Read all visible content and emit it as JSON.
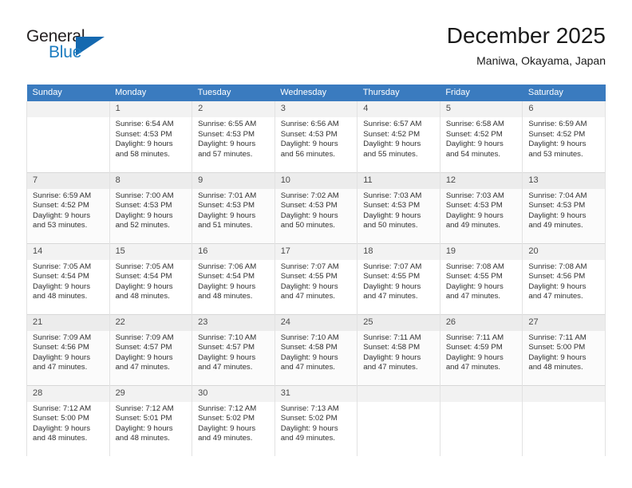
{
  "brand": {
    "name_top": "General",
    "name_bottom": "Blue",
    "accent_color": "#1c7cc0",
    "triangle_color": "#1569b0"
  },
  "header": {
    "title": "December 2025",
    "subtitle": "Maniwa, Okayama, Japan"
  },
  "calendar": {
    "header_bg": "#3a7bbf",
    "weekdays": [
      "Sunday",
      "Monday",
      "Tuesday",
      "Wednesday",
      "Thursday",
      "Friday",
      "Saturday"
    ],
    "labels": {
      "sunrise": "Sunrise:",
      "sunset": "Sunset:",
      "daylight": "Daylight:"
    },
    "weeks": [
      [
        {
          "day": "",
          "sunrise": "",
          "sunset": "",
          "daylight_1": "",
          "daylight_2": ""
        },
        {
          "day": "1",
          "sunrise": "Sunrise: 6:54 AM",
          "sunset": "Sunset: 4:53 PM",
          "daylight_1": "Daylight: 9 hours",
          "daylight_2": "and 58 minutes."
        },
        {
          "day": "2",
          "sunrise": "Sunrise: 6:55 AM",
          "sunset": "Sunset: 4:53 PM",
          "daylight_1": "Daylight: 9 hours",
          "daylight_2": "and 57 minutes."
        },
        {
          "day": "3",
          "sunrise": "Sunrise: 6:56 AM",
          "sunset": "Sunset: 4:53 PM",
          "daylight_1": "Daylight: 9 hours",
          "daylight_2": "and 56 minutes."
        },
        {
          "day": "4",
          "sunrise": "Sunrise: 6:57 AM",
          "sunset": "Sunset: 4:52 PM",
          "daylight_1": "Daylight: 9 hours",
          "daylight_2": "and 55 minutes."
        },
        {
          "day": "5",
          "sunrise": "Sunrise: 6:58 AM",
          "sunset": "Sunset: 4:52 PM",
          "daylight_1": "Daylight: 9 hours",
          "daylight_2": "and 54 minutes."
        },
        {
          "day": "6",
          "sunrise": "Sunrise: 6:59 AM",
          "sunset": "Sunset: 4:52 PM",
          "daylight_1": "Daylight: 9 hours",
          "daylight_2": "and 53 minutes."
        }
      ],
      [
        {
          "day": "7",
          "sunrise": "Sunrise: 6:59 AM",
          "sunset": "Sunset: 4:52 PM",
          "daylight_1": "Daylight: 9 hours",
          "daylight_2": "and 53 minutes."
        },
        {
          "day": "8",
          "sunrise": "Sunrise: 7:00 AM",
          "sunset": "Sunset: 4:53 PM",
          "daylight_1": "Daylight: 9 hours",
          "daylight_2": "and 52 minutes."
        },
        {
          "day": "9",
          "sunrise": "Sunrise: 7:01 AM",
          "sunset": "Sunset: 4:53 PM",
          "daylight_1": "Daylight: 9 hours",
          "daylight_2": "and 51 minutes."
        },
        {
          "day": "10",
          "sunrise": "Sunrise: 7:02 AM",
          "sunset": "Sunset: 4:53 PM",
          "daylight_1": "Daylight: 9 hours",
          "daylight_2": "and 50 minutes."
        },
        {
          "day": "11",
          "sunrise": "Sunrise: 7:03 AM",
          "sunset": "Sunset: 4:53 PM",
          "daylight_1": "Daylight: 9 hours",
          "daylight_2": "and 50 minutes."
        },
        {
          "day": "12",
          "sunrise": "Sunrise: 7:03 AM",
          "sunset": "Sunset: 4:53 PM",
          "daylight_1": "Daylight: 9 hours",
          "daylight_2": "and 49 minutes."
        },
        {
          "day": "13",
          "sunrise": "Sunrise: 7:04 AM",
          "sunset": "Sunset: 4:53 PM",
          "daylight_1": "Daylight: 9 hours",
          "daylight_2": "and 49 minutes."
        }
      ],
      [
        {
          "day": "14",
          "sunrise": "Sunrise: 7:05 AM",
          "sunset": "Sunset: 4:54 PM",
          "daylight_1": "Daylight: 9 hours",
          "daylight_2": "and 48 minutes."
        },
        {
          "day": "15",
          "sunrise": "Sunrise: 7:05 AM",
          "sunset": "Sunset: 4:54 PM",
          "daylight_1": "Daylight: 9 hours",
          "daylight_2": "and 48 minutes."
        },
        {
          "day": "16",
          "sunrise": "Sunrise: 7:06 AM",
          "sunset": "Sunset: 4:54 PM",
          "daylight_1": "Daylight: 9 hours",
          "daylight_2": "and 48 minutes."
        },
        {
          "day": "17",
          "sunrise": "Sunrise: 7:07 AM",
          "sunset": "Sunset: 4:55 PM",
          "daylight_1": "Daylight: 9 hours",
          "daylight_2": "and 47 minutes."
        },
        {
          "day": "18",
          "sunrise": "Sunrise: 7:07 AM",
          "sunset": "Sunset: 4:55 PM",
          "daylight_1": "Daylight: 9 hours",
          "daylight_2": "and 47 minutes."
        },
        {
          "day": "19",
          "sunrise": "Sunrise: 7:08 AM",
          "sunset": "Sunset: 4:55 PM",
          "daylight_1": "Daylight: 9 hours",
          "daylight_2": "and 47 minutes."
        },
        {
          "day": "20",
          "sunrise": "Sunrise: 7:08 AM",
          "sunset": "Sunset: 4:56 PM",
          "daylight_1": "Daylight: 9 hours",
          "daylight_2": "and 47 minutes."
        }
      ],
      [
        {
          "day": "21",
          "sunrise": "Sunrise: 7:09 AM",
          "sunset": "Sunset: 4:56 PM",
          "daylight_1": "Daylight: 9 hours",
          "daylight_2": "and 47 minutes."
        },
        {
          "day": "22",
          "sunrise": "Sunrise: 7:09 AM",
          "sunset": "Sunset: 4:57 PM",
          "daylight_1": "Daylight: 9 hours",
          "daylight_2": "and 47 minutes."
        },
        {
          "day": "23",
          "sunrise": "Sunrise: 7:10 AM",
          "sunset": "Sunset: 4:57 PM",
          "daylight_1": "Daylight: 9 hours",
          "daylight_2": "and 47 minutes."
        },
        {
          "day": "24",
          "sunrise": "Sunrise: 7:10 AM",
          "sunset": "Sunset: 4:58 PM",
          "daylight_1": "Daylight: 9 hours",
          "daylight_2": "and 47 minutes."
        },
        {
          "day": "25",
          "sunrise": "Sunrise: 7:11 AM",
          "sunset": "Sunset: 4:58 PM",
          "daylight_1": "Daylight: 9 hours",
          "daylight_2": "and 47 minutes."
        },
        {
          "day": "26",
          "sunrise": "Sunrise: 7:11 AM",
          "sunset": "Sunset: 4:59 PM",
          "daylight_1": "Daylight: 9 hours",
          "daylight_2": "and 47 minutes."
        },
        {
          "day": "27",
          "sunrise": "Sunrise: 7:11 AM",
          "sunset": "Sunset: 5:00 PM",
          "daylight_1": "Daylight: 9 hours",
          "daylight_2": "and 48 minutes."
        }
      ],
      [
        {
          "day": "28",
          "sunrise": "Sunrise: 7:12 AM",
          "sunset": "Sunset: 5:00 PM",
          "daylight_1": "Daylight: 9 hours",
          "daylight_2": "and 48 minutes."
        },
        {
          "day": "29",
          "sunrise": "Sunrise: 7:12 AM",
          "sunset": "Sunset: 5:01 PM",
          "daylight_1": "Daylight: 9 hours",
          "daylight_2": "and 48 minutes."
        },
        {
          "day": "30",
          "sunrise": "Sunrise: 7:12 AM",
          "sunset": "Sunset: 5:02 PM",
          "daylight_1": "Daylight: 9 hours",
          "daylight_2": "and 49 minutes."
        },
        {
          "day": "31",
          "sunrise": "Sunrise: 7:13 AM",
          "sunset": "Sunset: 5:02 PM",
          "daylight_1": "Daylight: 9 hours",
          "daylight_2": "and 49 minutes."
        },
        {
          "day": "",
          "sunrise": "",
          "sunset": "",
          "daylight_1": "",
          "daylight_2": ""
        },
        {
          "day": "",
          "sunrise": "",
          "sunset": "",
          "daylight_1": "",
          "daylight_2": ""
        },
        {
          "day": "",
          "sunrise": "",
          "sunset": "",
          "daylight_1": "",
          "daylight_2": ""
        }
      ]
    ]
  }
}
